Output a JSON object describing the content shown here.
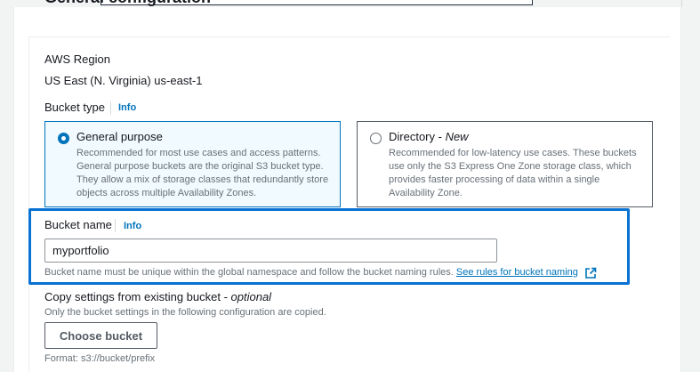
{
  "section": {
    "title": "General configuration"
  },
  "region": {
    "label": "AWS Region",
    "value": "US East (N. Virginia) us-east-1"
  },
  "bucket_type": {
    "label": "Bucket type",
    "info": "Info",
    "options": [
      {
        "title": "General purpose",
        "title_suffix": "",
        "selected": true,
        "description": "Recommended for most use cases and access patterns. General purpose buckets are the original S3 bucket type. They allow a mix of storage classes that redundantly store objects across multiple Availability Zones."
      },
      {
        "title": "Directory - ",
        "title_suffix": "New",
        "selected": false,
        "description": "Recommended for low-latency use cases. These buckets use only the S3 Express One Zone storage class, which provides faster processing of data within a single Availability Zone."
      }
    ]
  },
  "bucket_name": {
    "label": "Bucket name",
    "info": "Info",
    "value": "myportfolio",
    "hint": "Bucket name must be unique within the global namespace and follow the bucket naming rules.",
    "hint_link": "See rules for bucket naming"
  },
  "copy_settings": {
    "label": "Copy settings from existing bucket - ",
    "label_optional": "optional",
    "description": "Only the bucket settings in the following configuration are copied.",
    "button_label": "Choose bucket",
    "format_hint": "Format: s3://bucket/prefix"
  },
  "colors": {
    "accent": "#0073bb",
    "highlight": "#0972d3"
  },
  "icons": {
    "external_link": "external-link-icon"
  }
}
